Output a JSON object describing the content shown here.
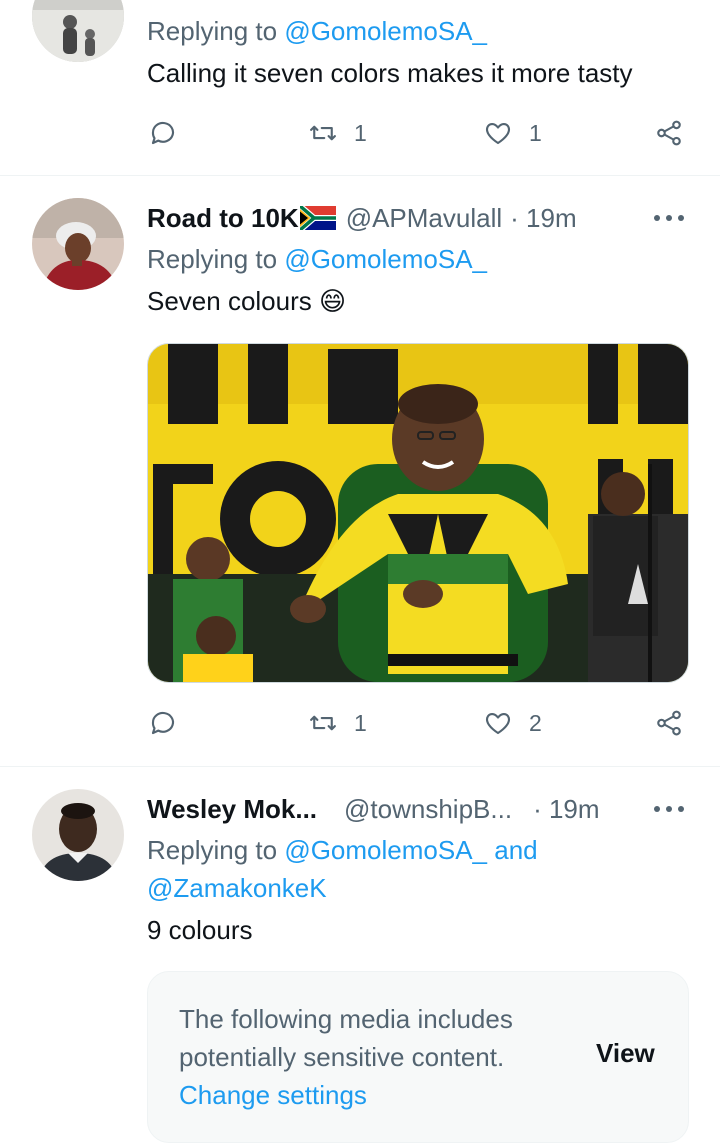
{
  "tweets": [
    {
      "replying_prefix": "Replying to",
      "replying_to": "@GomolemoSA_",
      "text": "Calling it seven colors makes it more tasty",
      "retweets": "1",
      "likes": "1"
    },
    {
      "name": "Road to 10K",
      "flag_icon": "south-africa-flag-icon",
      "handle": "@APMavulall",
      "time": "· 19m",
      "replying_prefix": "Replying to",
      "replying_to": "@GomolemoSA_",
      "text": "Seven colours",
      "emoji": "😄",
      "retweets": "1",
      "likes": "2"
    },
    {
      "name": "Wesley Mok...",
      "handle": "@townshipB...",
      "time": "· 19m",
      "replying_prefix": "Replying to",
      "replying_to": "@GomolemoSA_ and",
      "replying_to_2": "@ZamakonkeK",
      "text": "9 colours",
      "sensitive_line1": "The following media includes",
      "sensitive_line2": "potentially sensitive content.",
      "sensitive_link": "Change settings",
      "view_label": "View"
    }
  ],
  "colors": {
    "accent": "#1d9bf0",
    "secondary_text": "#536471",
    "primary_text": "#0f1419",
    "divider": "#eff3f4"
  }
}
